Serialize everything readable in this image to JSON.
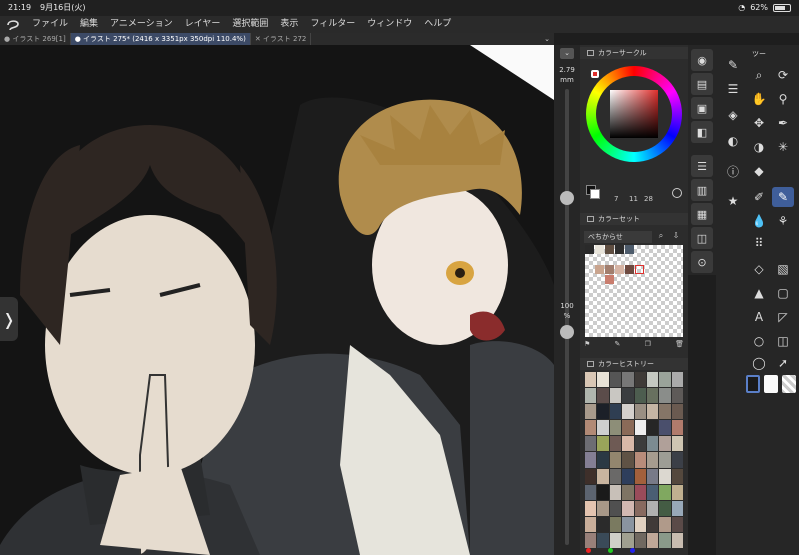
{
  "status": {
    "time": "21:19",
    "date": "9月16日(火)",
    "battery": "62%"
  },
  "menu": {
    "items": [
      "ファイル",
      "編集",
      "アニメーション",
      "レイヤー",
      "選択範囲",
      "表示",
      "フィルター",
      "ウィンドウ",
      "ヘルプ"
    ]
  },
  "tabs": [
    {
      "label": "● イラスト 269[1]",
      "active": false
    },
    {
      "label": "● イラスト 275* (2416 x 3351px 350dpi 110.4%)",
      "active": true
    },
    {
      "label": "✕ イラスト 272",
      "active": false
    }
  ],
  "brush": {
    "size": "2.79",
    "size_unit": "mm",
    "opacity": "100",
    "opacity_unit": "%",
    "size_level": 0.55,
    "opacity_level": 1.0
  },
  "color_circle": {
    "title": "カラーサークル",
    "values": [
      "7",
      "11",
      "28"
    ]
  },
  "color_set": {
    "title": "カラーセット",
    "selected": "べちからせ"
  },
  "color_history": {
    "title": "カラーヒストリー"
  },
  "palette_colors": [
    "#2a2a2a",
    "#e8e4da",
    "#5e4d40",
    "#2e2e2e",
    "#4d5b6b",
    "#c9a48e",
    "#a27e6e",
    "#d6b4a4",
    "#6e4a40",
    "#c97d6e",
    "#e0302d"
  ],
  "history_colors": [
    "#d9c7b5",
    "#e8e2d6",
    "#555",
    "#777",
    "#3e3a37",
    "#c4c8c1",
    "#9aa39a",
    "#aaa",
    "#b0b6ae",
    "#5b4c4a",
    "#c9c7c2",
    "#3a3d3f",
    "#4d5d4f",
    "#68705f",
    "#8a8d8a",
    "#5e5a58",
    "#a99b8c",
    "#1c2028",
    "#2f3e52",
    "#d4d0cc",
    "#9a8f83",
    "#c5b5a4",
    "#857567",
    "#6a5a50",
    "#b28a76",
    "#cfcfcf",
    "#8d8e78",
    "#8a6a58",
    "#eeeeee",
    "#262626",
    "#4a4f6c",
    "#b17b6c",
    "#6d6d73",
    "#9aa45a",
    "#6e5a54",
    "#d8b8a8",
    "#3c3c3c",
    "#7c8b91",
    "#b0a099",
    "#cfc5b2",
    "#847f94",
    "#2b3944",
    "#93866e",
    "#5f5245",
    "#b88c7a",
    "#a69c8f",
    "#9d9d95",
    "#3b3f47",
    "#3e2f2a",
    "#c8b49f",
    "#6a6968",
    "#2e3e5c",
    "#a3603c",
    "#787a88",
    "#dcd8d0",
    "#54483d",
    "#5c6470",
    "#1a1a1a",
    "#c8c0b8",
    "#7e7464",
    "#9a4b5a",
    "#4a5e73",
    "#80a860",
    "#c0b090",
    "#e4c4b0",
    "#a89888",
    "#505050",
    "#d2b8b2",
    "#886a60",
    "#b0b0b0",
    "#445c44",
    "#98a8b8",
    "#c9ae9a",
    "#2b2b2b",
    "#7a7a60",
    "#8a94a0",
    "#e0d0c0",
    "#403a38",
    "#b09a8a",
    "#5a4a48",
    "#98807a",
    "#3a4a58",
    "#d0d0c8",
    "#a0a090",
    "#706860",
    "#c0a898",
    "#8a9a8a",
    "#c8bcb0"
  ],
  "tools_title": "ツー"
}
